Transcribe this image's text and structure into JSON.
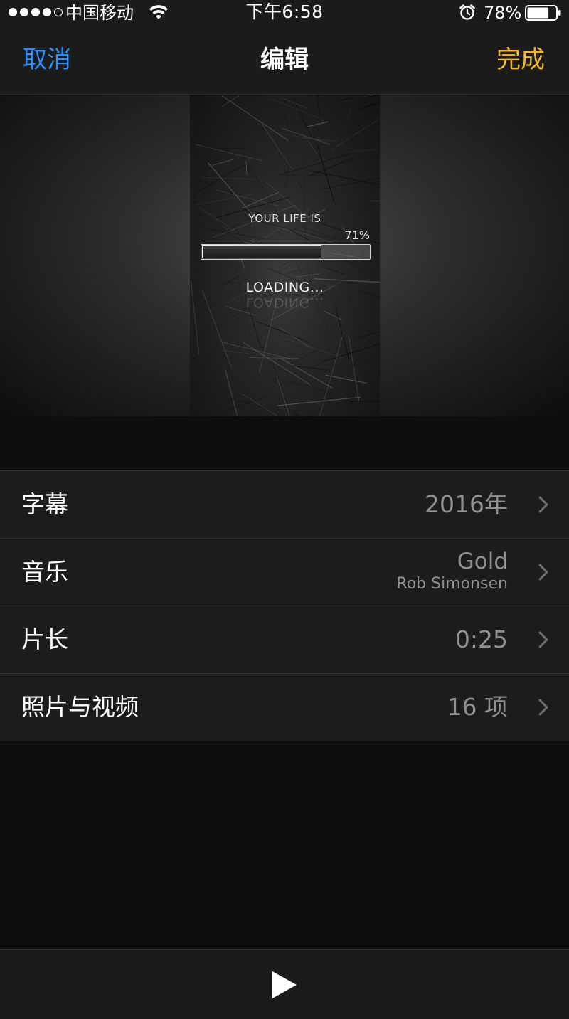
{
  "status_bar": {
    "signal_dots_filled": 4,
    "signal_dots_total": 5,
    "carrier": "中国移动",
    "wifi_icon": "wifi-icon",
    "time": "下午6:58",
    "alarm_icon": "alarm-clock-icon",
    "battery_percent": "78%",
    "battery_level": 0.78
  },
  "nav": {
    "cancel_label": "取消",
    "title": "编辑",
    "done_label": "完成",
    "cancel_color": "#2f8ef4",
    "done_color": "#f2b632"
  },
  "preview": {
    "tagline": "YOUR LIFE IS",
    "percent_text": "71%",
    "progress": 0.71,
    "loading_text": "LOADING..."
  },
  "settings": {
    "rows": [
      {
        "label": "字幕",
        "value": "2016年",
        "icon": "chevron-right-icon"
      },
      {
        "label": "音乐",
        "value": "Gold",
        "subvalue": "Rob Simonsen",
        "icon": "chevron-right-icon"
      },
      {
        "label": "片长",
        "value": "0:25",
        "icon": "chevron-right-icon"
      },
      {
        "label": "照片与视频",
        "value": "16 项",
        "icon": "chevron-right-icon"
      }
    ]
  },
  "toolbar": {
    "play_icon": "play-icon"
  }
}
